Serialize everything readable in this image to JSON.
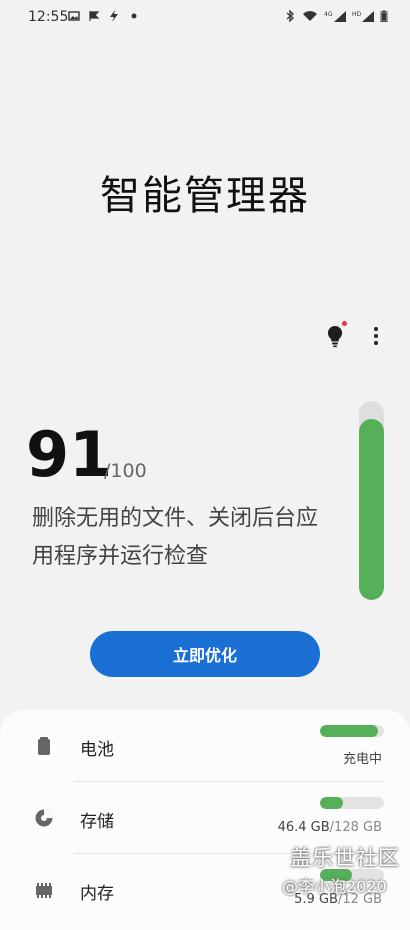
{
  "status_bar": {
    "time": "12:55",
    "left_icons": [
      "image-icon",
      "flag-icon",
      "flash-icon",
      "dot-icon"
    ],
    "right_icons": [
      "bluetooth-icon",
      "wifi-icon",
      "signal-4g-icon",
      "signal-hd-icon",
      "battery-icon"
    ]
  },
  "header": {
    "title": "智能管理器"
  },
  "toolbar": {
    "tip_icon": "lightbulb-icon",
    "more_icon": "more-vert-icon"
  },
  "score": {
    "value": "91",
    "max_label": "/100",
    "description": "删除无用的文件、关闭后台应用程序并运行检查",
    "fill_fraction": 0.91,
    "color": "#56b05a"
  },
  "optimize_button": {
    "label": "立即优化",
    "color": "#1a6fd5"
  },
  "items": [
    {
      "name": "battery",
      "icon": "battery-icon",
      "label": "电池",
      "fill_fraction": 0.9,
      "value": "充电中",
      "total": ""
    },
    {
      "name": "storage",
      "icon": "storage-pie-icon",
      "label": "存储",
      "fill_fraction": 0.36,
      "value": "46.4 GB",
      "total": "/128 GB"
    },
    {
      "name": "memory",
      "icon": "memory-chip-icon",
      "label": "内存",
      "fill_fraction": 0.5,
      "value": "5.9 GB",
      "total": "/12 GB"
    }
  ],
  "watermark": {
    "line1": "盖乐世社区",
    "line2": "@李小泡2020"
  }
}
